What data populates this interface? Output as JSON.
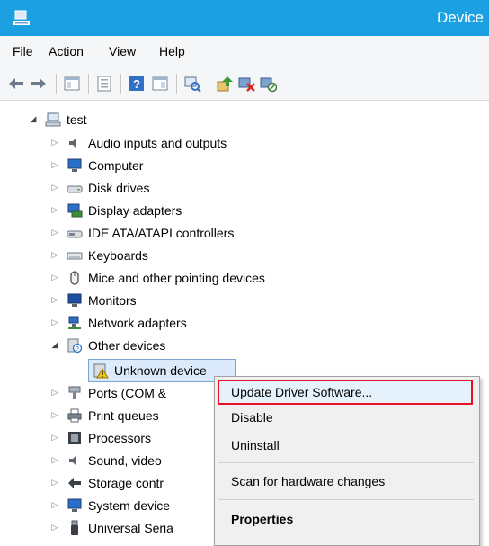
{
  "window": {
    "title": "Device"
  },
  "menu": [
    "File",
    "Action",
    "View",
    "Help"
  ],
  "toolbar": {
    "buttons": [
      "back-arrow-icon",
      "forward-arrow-icon",
      "show-hide-console-tree-icon",
      "properties-icon",
      "help-icon",
      "action-pane-icon",
      "scan-hardware-icon",
      "update-driver-icon",
      "uninstall-device-icon",
      "disable-device-icon"
    ]
  },
  "tree": {
    "root": "test",
    "items": [
      {
        "label": "Audio inputs and outputs",
        "icon": "speaker-icon"
      },
      {
        "label": "Computer",
        "icon": "computer-icon"
      },
      {
        "label": "Disk drives",
        "icon": "disk-drive-icon"
      },
      {
        "label": "Display adapters",
        "icon": "display-adapter-icon"
      },
      {
        "label": "IDE ATA/ATAPI controllers",
        "icon": "ide-controller-icon"
      },
      {
        "label": "Keyboards",
        "icon": "keyboard-icon"
      },
      {
        "label": "Mice and other pointing devices",
        "icon": "mouse-icon"
      },
      {
        "label": "Monitors",
        "icon": "monitor-icon"
      },
      {
        "label": "Network adapters",
        "icon": "network-adapter-icon"
      },
      {
        "label": "Other devices",
        "icon": "other-devices-icon",
        "expanded": true
      },
      {
        "label": "Unknown device",
        "icon": "warning-device-icon",
        "child": true,
        "selected": true
      },
      {
        "label": "Ports (COM &",
        "icon": "port-icon"
      },
      {
        "label": "Print queues",
        "icon": "printer-icon"
      },
      {
        "label": "Processors",
        "icon": "processor-icon"
      },
      {
        "label": "Sound, video",
        "icon": "speaker-icon"
      },
      {
        "label": "Storage contr",
        "icon": "storage-icon"
      },
      {
        "label": "System device",
        "icon": "system-device-icon"
      },
      {
        "label": "Universal Seria",
        "icon": "usb-icon"
      }
    ]
  },
  "context_menu": {
    "update": "Update Driver Software...",
    "disable": "Disable",
    "uninstall": "Uninstall",
    "scan": "Scan for hardware changes",
    "properties": "Properties"
  },
  "colors": {
    "titlebar": "#1ba1e2",
    "highlight_border": "#e81123",
    "selection": "#dcebfc"
  }
}
